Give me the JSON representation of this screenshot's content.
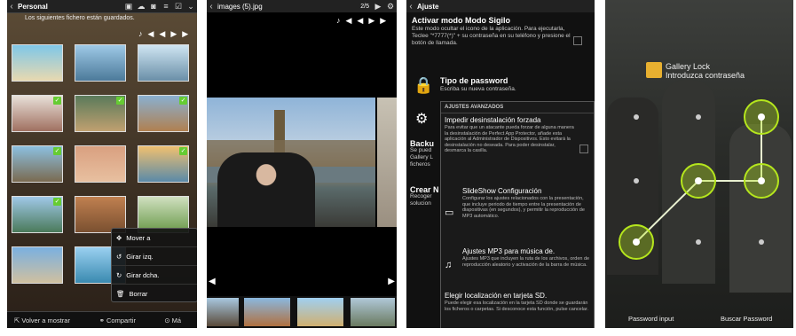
{
  "p1": {
    "title": "Personal",
    "hint": "Los siguientes fichero están guardados.",
    "menu": [
      "Mover a",
      "Girar izq.",
      "Girar dcha.",
      "Borrar"
    ],
    "bottom": [
      "Volver a mostrar",
      "Compartir",
      "Má"
    ]
  },
  "p2": {
    "title": "images (5).jpg",
    "counter": "2/5"
  },
  "p3": {
    "title": "Ajuste",
    "s1h": "Activar modo Modo Sigilo",
    "s1d": "Este modo ocultar el icono de la aplicación. Para ejecutarla, Teclee \"*7777(*)\" + su contraseña en su teléfono y presione el botón de llamada.",
    "s2h": "Tipo de password",
    "s2d": "Escriba su nueva contraseña.",
    "partial": [
      "Backu",
      "Se pued",
      "Gallery L",
      "ficheros",
      "Crear N",
      "Recoger",
      "solucion"
    ],
    "dlg": {
      "title": "AJUSTES AVANZADOS",
      "r1h": "Impedir desinstalación forzada",
      "r1d": "Para evitar que un atacante pueda forzar de alguna manera la desinstalación de Perfect App Protector, añade esta aplicación al Administrador de Dispositivos. Esto evitará la desinstalación no deseada. Para poder desinstalar, desmarca la casilla.",
      "r2h": "SlideShow Configuración",
      "r2d": "Configurar los ajustes relacionados con la presentación, que incluye periodo de tiempo entre la presentación de diapositivas (en segundos), y permitir la reproducción de MP3 automático.",
      "r3h": "Ajustes MP3 para música de.",
      "r3d": "Ajustes MP3 que incluyen la ruta de los archivos, orden de reproducción aleatorio y activación de la barra de música.",
      "r4h": "Elegir localización en tarjeta SD.",
      "r4d": "Puede elegir esa localización en la tarjeta SD donde se guardarán los ficheros o carpetas. Si desconoce esta función, pulse cancelar."
    }
  },
  "p4": {
    "app": "Gallery Lock",
    "prompt": "Introduzca contraseña",
    "left": "Password input",
    "right": "Buscar Password",
    "accent": "#b5e61d"
  }
}
